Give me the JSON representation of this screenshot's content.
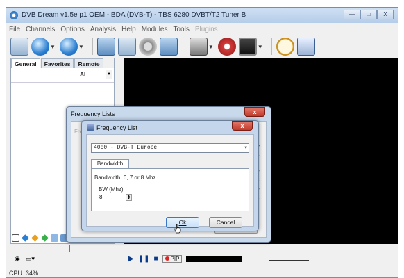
{
  "window": {
    "title": "DVB Dream v1.5e p1 OEM - BDA (DVB-T) - TBS 6280 DVBT/T2 Tuner B",
    "buttons": [
      "—",
      "□",
      "X"
    ]
  },
  "menu": [
    "File",
    "Channels",
    "Options",
    "Analysis",
    "Help",
    "Modules",
    "Tools",
    "Plugins"
  ],
  "toolbar": {
    "icons": [
      "recordings-folder-icon",
      "back-icon",
      "forward-icon",
      "tv-icon",
      "window-icon",
      "settings-gear-icon",
      "capture-icon",
      "film-icon",
      "record-icon",
      "monitor-icon",
      "timer-clock-icon",
      "epg-icon"
    ]
  },
  "left_panel": {
    "tabs": [
      "General",
      "Favorites",
      "Remote"
    ],
    "filter_value": "Al"
  },
  "frequency_lists_dialog": {
    "title": "Frequency Lists",
    "close_label": "x",
    "faded_label": "Fre"
  },
  "frequency_list_dialog": {
    "title": "Frequency List",
    "close_label": "x",
    "selected_list": "4000 - DVB-T Europe",
    "tab_label": "Bandwidth",
    "bandwidth_text": "Bandwidth: 6, 7 or 8 Mhz",
    "bw_caption": "BW (Mhz)",
    "bw_value": "8",
    "ok_label": "Ok",
    "cancel_label": "Cancel"
  },
  "player": {
    "pip_label": "PIP"
  },
  "status": {
    "cpu": "CPU: 34%"
  }
}
